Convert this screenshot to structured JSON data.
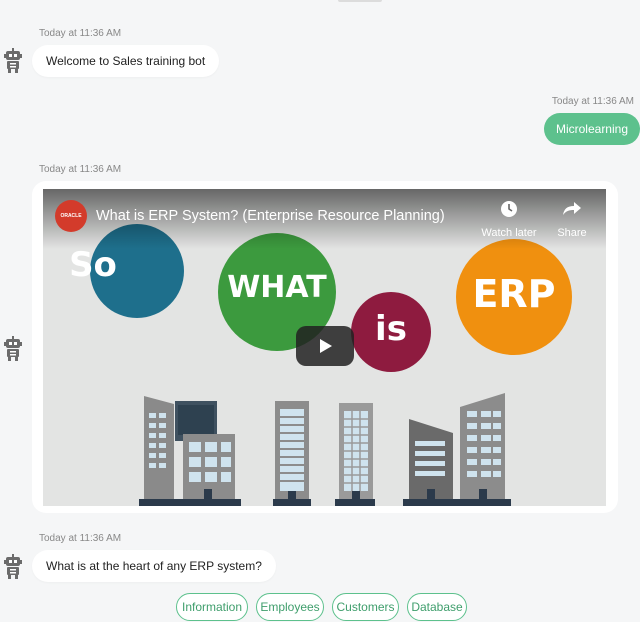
{
  "messages": [
    {
      "timestamp": "Today at 11:36 AM",
      "text": "Welcome to Sales training bot"
    },
    {
      "timestamp": "Today at 11:36 AM",
      "text": "Microlearning"
    },
    {
      "timestamp": "Today at 11:36 AM"
    },
    {
      "timestamp": "Today at 11:36 AM",
      "text": "What is at the heart of any ERP system?"
    }
  ],
  "video": {
    "channel_logo": "ORACLE",
    "title": "What is ERP System? (Enterprise Resource Planning)",
    "watch_later": "Watch later",
    "share": "Share",
    "words": [
      "So",
      "WHAT",
      "is",
      "ERP"
    ]
  },
  "quick_replies": [
    "Information",
    "Employees",
    "Customers",
    "Database"
  ],
  "colors": {
    "accent": "#5dc18d",
    "so": "#1e6f8c",
    "what": "#3c9a3e",
    "is": "#8e1b3f",
    "erp": "#f0900f",
    "logo": "#d33b2b"
  },
  "icons": [
    "robot-icon",
    "clock-icon",
    "share-icon",
    "play-icon"
  ]
}
